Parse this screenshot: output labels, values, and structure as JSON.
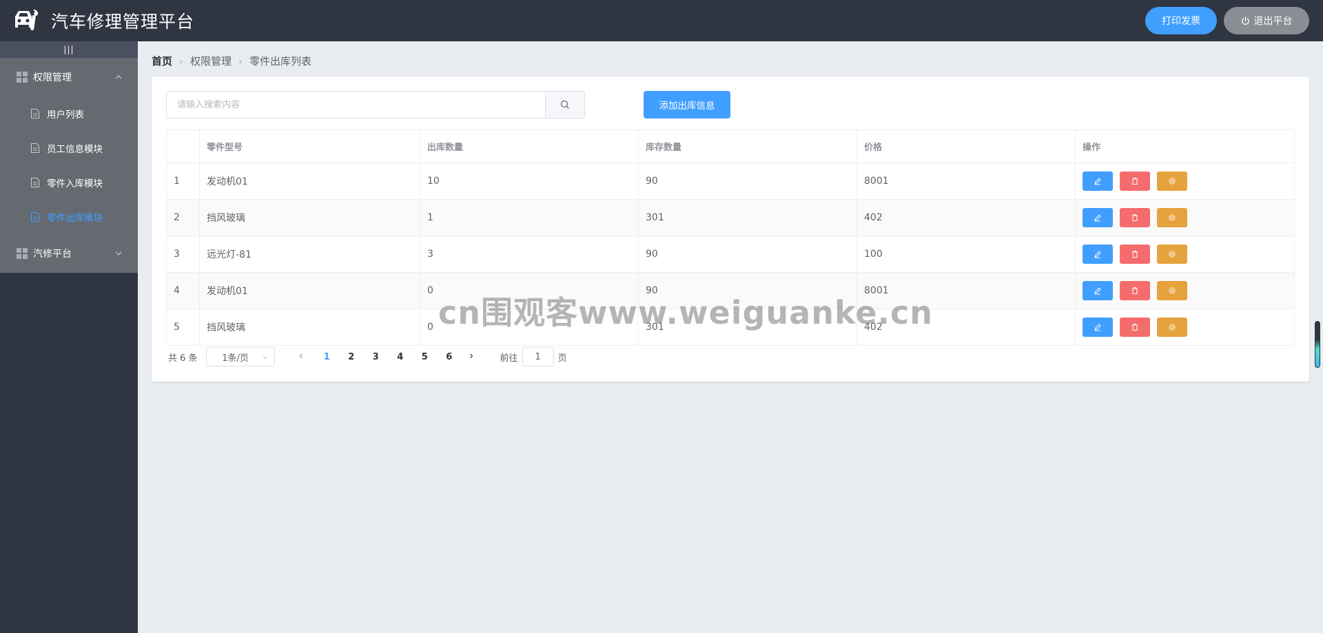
{
  "header": {
    "title": "汽车修理管理平台",
    "print_invoice": "打印发票",
    "logout": "退出平台",
    "logo_icon": "car-wrench-icon"
  },
  "sidebar": {
    "toggle_label": "|||",
    "groups": [
      {
        "label": "权限管理",
        "expanded": true,
        "items": [
          {
            "label": "用户列表"
          },
          {
            "label": "员工信息模块"
          },
          {
            "label": "零件入库模块"
          },
          {
            "label": "零件出库模块",
            "active": true
          }
        ]
      },
      {
        "label": "汽修平台",
        "expanded": false
      }
    ]
  },
  "breadcrumb": [
    "首页",
    "权限管理",
    "零件出库列表"
  ],
  "search": {
    "placeholder": "请输入搜索内容",
    "value": ""
  },
  "add_button": "添加出库信息",
  "table": {
    "columns": [
      "",
      "零件型号",
      "出库数量",
      "库存数量",
      "价格",
      "操作"
    ],
    "rows": [
      {
        "index": "1",
        "model": "发动机01",
        "out_qty": "10",
        "stock_qty": "90",
        "price": "8001"
      },
      {
        "index": "2",
        "model": "挡风玻璃",
        "out_qty": "1",
        "stock_qty": "301",
        "price": "402"
      },
      {
        "index": "3",
        "model": "远光灯-81",
        "out_qty": "3",
        "stock_qty": "90",
        "price": "100"
      },
      {
        "index": "4",
        "model": "发动机01",
        "out_qty": "0",
        "stock_qty": "90",
        "price": "8001"
      },
      {
        "index": "5",
        "model": "挡风玻璃",
        "out_qty": "0",
        "stock_qty": "301",
        "price": "402"
      }
    ],
    "actions": [
      "edit-icon",
      "delete-icon",
      "settings-icon"
    ]
  },
  "pagination": {
    "total": "共 6 条",
    "page_size": "1条/页",
    "pages": [
      "1",
      "2",
      "3",
      "4",
      "5",
      "6"
    ],
    "current_page": "1",
    "goto_prefix": "前往",
    "goto_value": "1",
    "goto_suffix": "页"
  },
  "watermark": "cn围观客www.weiguanke.cn",
  "colors": {
    "header_bg": "#2f3541",
    "primary": "#409eff",
    "danger": "#f56c6c",
    "warning": "#e6a23c",
    "gray_button": "#8a8d93",
    "menu_bg": "#656a70"
  }
}
